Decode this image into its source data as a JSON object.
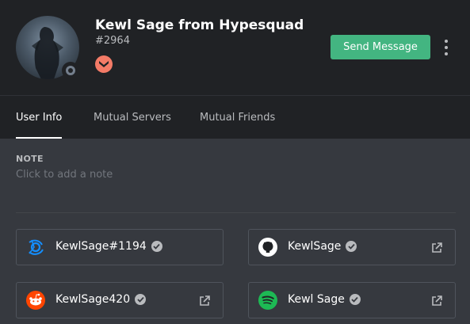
{
  "profile": {
    "username": "Kewl Sage from Hypesquad",
    "discriminator": "#2964",
    "status": "offline"
  },
  "actions": {
    "send_message_label": "Send Message"
  },
  "tabs": [
    {
      "label": "User Info",
      "active": true
    },
    {
      "label": "Mutual Servers",
      "active": false
    },
    {
      "label": "Mutual Friends",
      "active": false
    }
  ],
  "note": {
    "label": "NOTE",
    "placeholder": "Click to add a note"
  },
  "connections": [
    {
      "service": "battlenet",
      "icon": "battlenet-icon",
      "name": "KewlSage#1194",
      "verified": true,
      "external_link": false
    },
    {
      "service": "github",
      "icon": "github-icon",
      "name": "KewlSage",
      "verified": true,
      "external_link": true
    },
    {
      "service": "reddit",
      "icon": "reddit-icon",
      "name": "KewlSage420",
      "verified": true,
      "external_link": true
    },
    {
      "service": "spotify",
      "icon": "spotify-icon",
      "name": "Kewl Sage",
      "verified": true,
      "external_link": true
    }
  ],
  "colors": {
    "header_bg": "#202225",
    "body_bg": "#36393f",
    "send_button": "#43b581",
    "hypesquad_badge": "#f47b67",
    "offline_status": "#747f8d"
  }
}
